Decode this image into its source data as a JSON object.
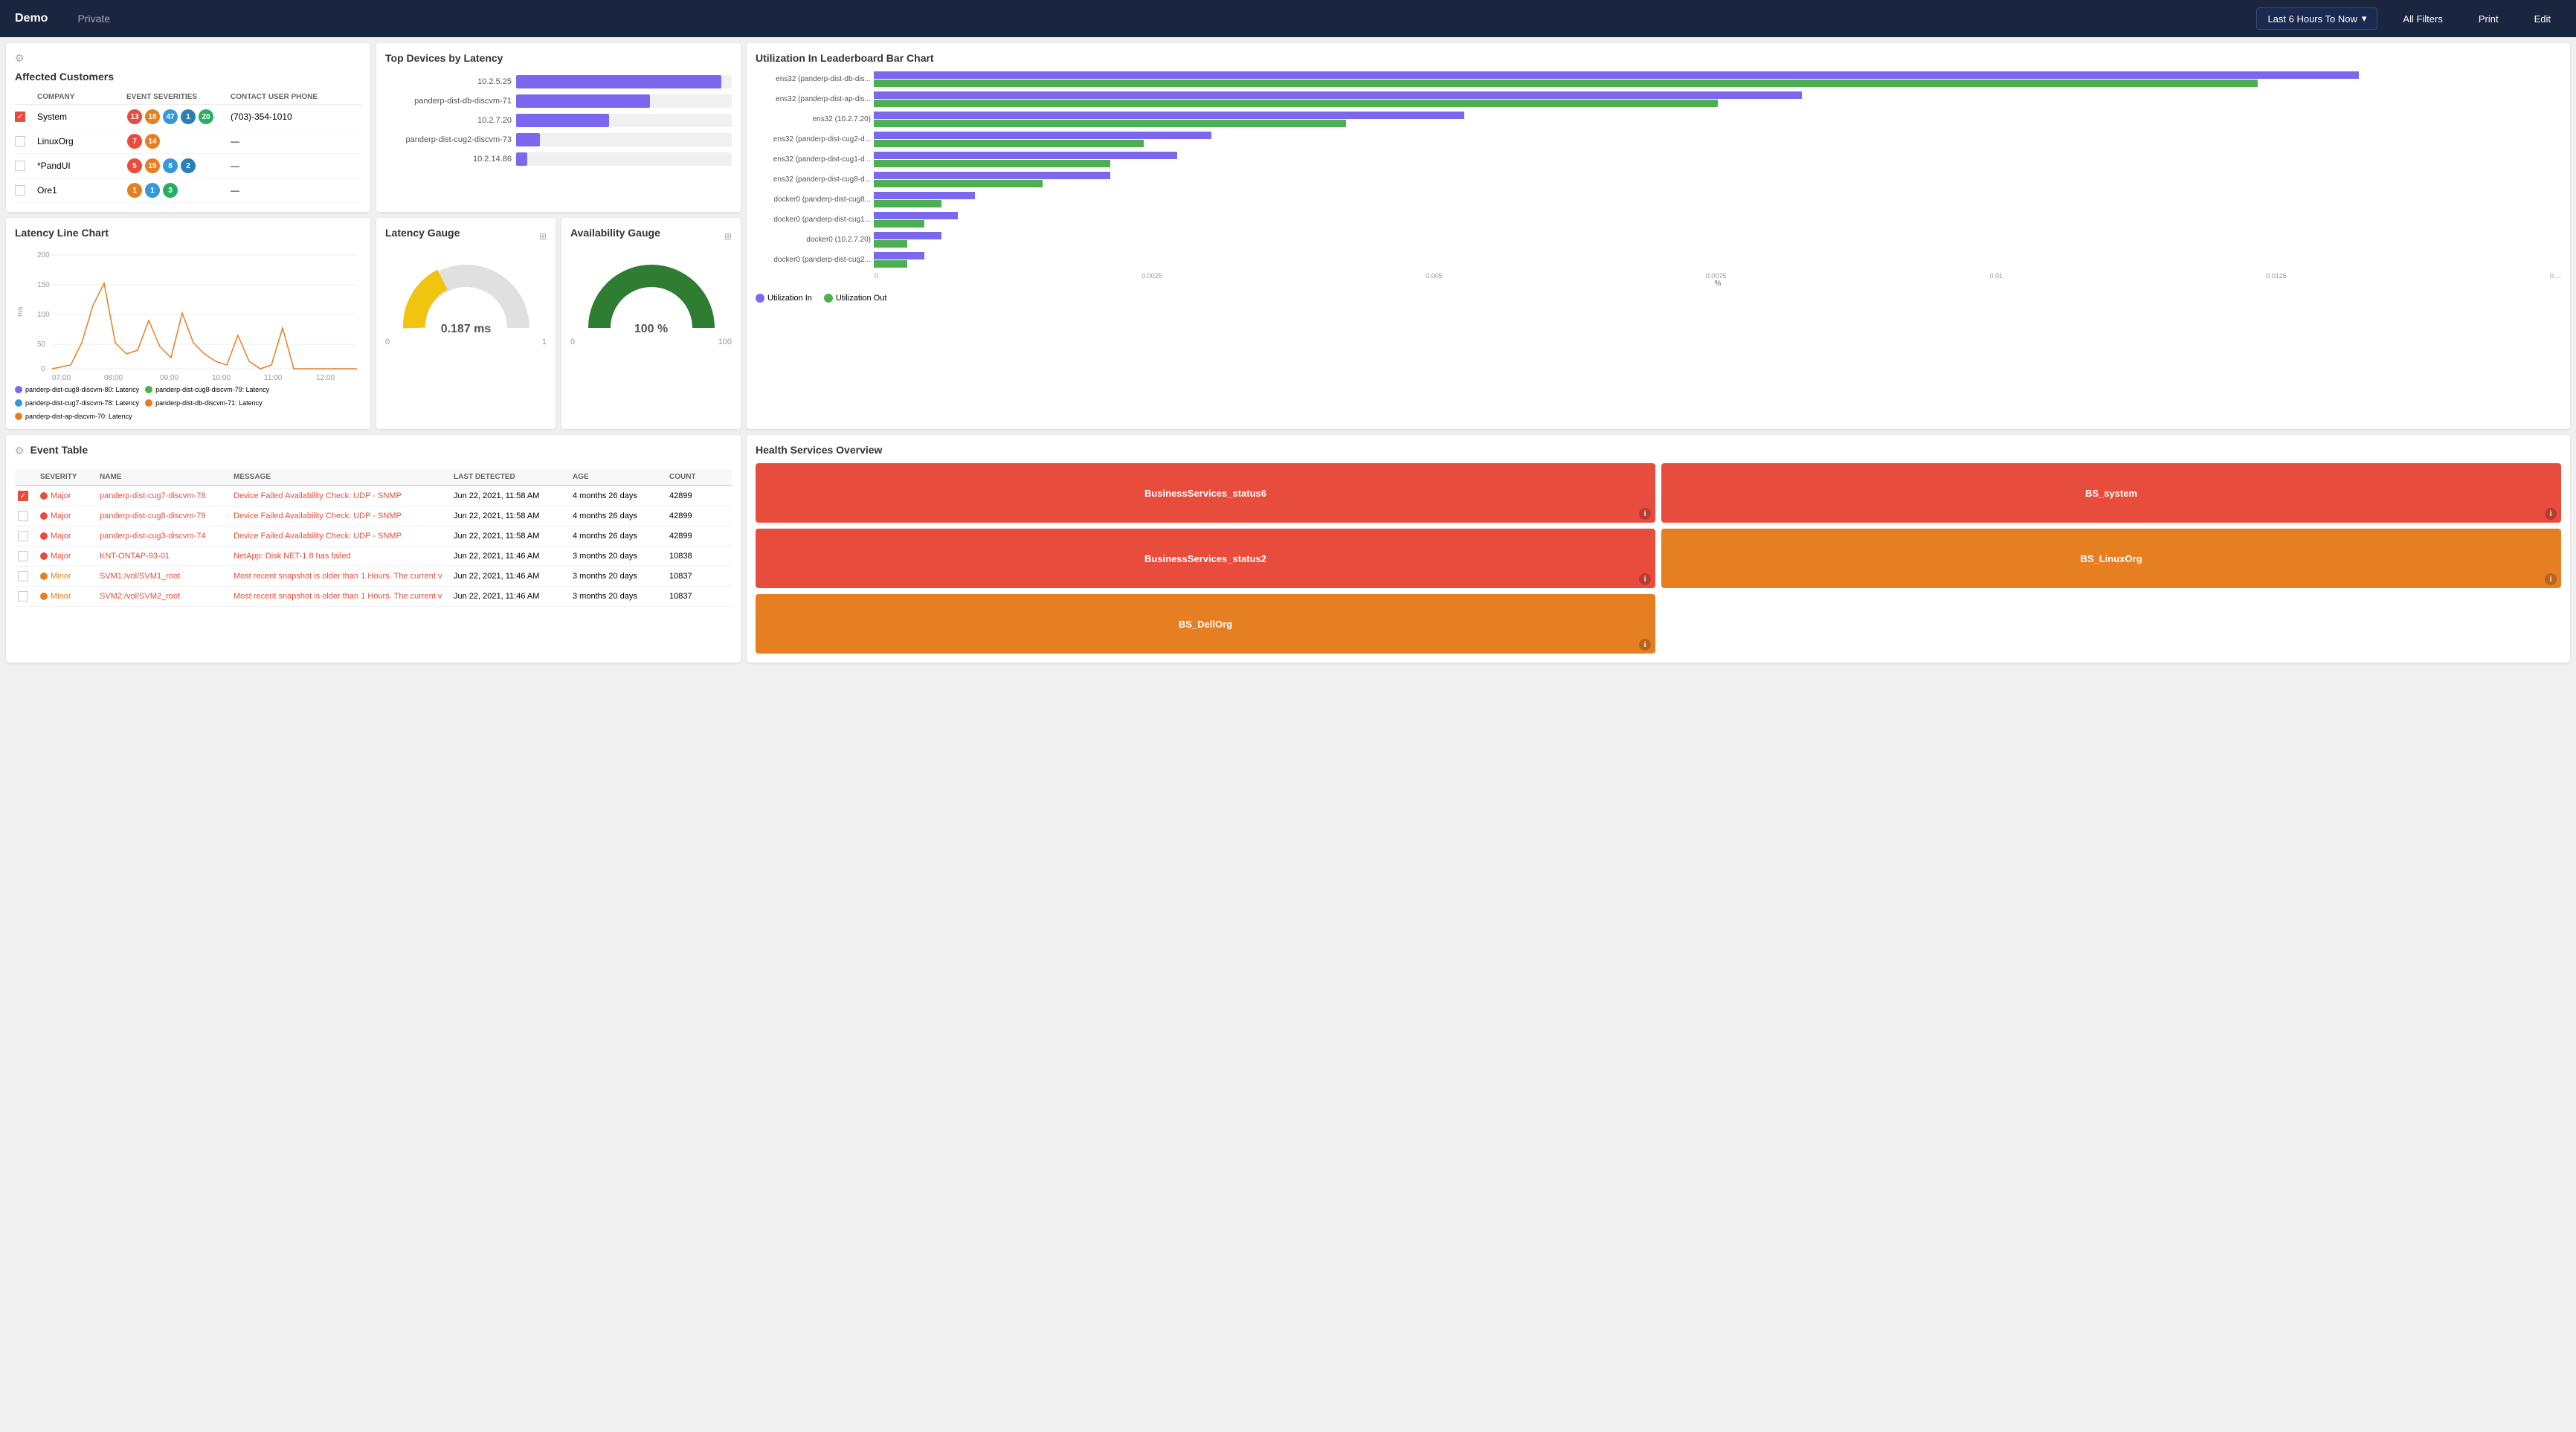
{
  "nav": {
    "title": "Demo",
    "private": "Private",
    "time_filter": "Last 6 Hours To Now",
    "all_filters": "All Filters",
    "print": "Print",
    "edit": "Edit"
  },
  "affected_customers": {
    "title": "Affected Customers",
    "columns": [
      "COMPANY",
      "EVENT SEVERITIES",
      "CONTACT USER PHONE"
    ],
    "rows": [
      {
        "company": "System",
        "severities": [
          {
            "val": "13",
            "cls": "badge-red"
          },
          {
            "val": "18",
            "cls": "badge-orange"
          },
          {
            "val": "47",
            "cls": "badge-blue-light"
          },
          {
            "val": "1",
            "cls": "badge-blue"
          },
          {
            "val": "20",
            "cls": "badge-green"
          }
        ],
        "phone": "(703)-354-1010",
        "checked": true
      },
      {
        "company": "LinuxOrg",
        "severities": [
          {
            "val": "7",
            "cls": "badge-red"
          },
          {
            "val": "14",
            "cls": "badge-orange"
          }
        ],
        "phone": "—",
        "checked": false
      },
      {
        "company": "*PandUI",
        "severities": [
          {
            "val": "5",
            "cls": "badge-red"
          },
          {
            "val": "15",
            "cls": "badge-orange"
          },
          {
            "val": "8",
            "cls": "badge-blue-light"
          },
          {
            "val": "2",
            "cls": "badge-blue"
          }
        ],
        "phone": "—",
        "checked": false
      },
      {
        "company": "Ore1",
        "severities": [
          {
            "val": "1",
            "cls": "badge-orange"
          },
          {
            "val": "1",
            "cls": "badge-blue-light"
          },
          {
            "val": "3",
            "cls": "badge-green"
          }
        ],
        "phone": "—",
        "checked": false
      }
    ]
  },
  "top_devices": {
    "title": "Top Devices by Latency",
    "bars": [
      {
        "label": "10.2.5.25",
        "value": 100,
        "pct": 95
      },
      {
        "label": "panderp-dist-db-discvm-71",
        "value": 65,
        "pct": 62
      },
      {
        "label": "10.2.7.20",
        "value": 45,
        "pct": 43
      },
      {
        "label": "panderp-dist-cug2-discvm-73",
        "value": 12,
        "pct": 11
      },
      {
        "label": "10.2.14.86",
        "value": 5,
        "pct": 5
      }
    ]
  },
  "utilization": {
    "title": "Utilization In Leaderboard Bar Chart",
    "x_labels": [
      "0",
      "0.0025",
      "0.005",
      "0.0075",
      "0.01",
      "0.0125",
      "0...."
    ],
    "x_axis_label": "%",
    "legend_in": "Utilization In",
    "legend_out": "Utilization Out",
    "bars": [
      {
        "label": "ens32 (panderp-dist-db-dis...",
        "in_pct": 88,
        "out_pct": 82
      },
      {
        "label": "ens32 (panderp-dist-ap-dis...",
        "in_pct": 55,
        "out_pct": 50
      },
      {
        "label": "ens32 (10.2.7.20)",
        "in_pct": 35,
        "out_pct": 28
      },
      {
        "label": "ens32 (panderp-dist-cug2-d...",
        "in_pct": 20,
        "out_pct": 16
      },
      {
        "label": "ens32 (panderp-dist-cug1-d...",
        "in_pct": 18,
        "out_pct": 14
      },
      {
        "label": "ens32 (panderp-dist-cug8-d...",
        "in_pct": 14,
        "out_pct": 10
      },
      {
        "label": "docker0 (panderp-dist-cug8...",
        "in_pct": 6,
        "out_pct": 4
      },
      {
        "label": "docker0 (panderp-dist-cug1...",
        "in_pct": 5,
        "out_pct": 3
      },
      {
        "label": "docker0 (10.2.7.20)",
        "in_pct": 4,
        "out_pct": 2
      },
      {
        "label": "docker0 (panderp-dist-cug2...",
        "in_pct": 3,
        "out_pct": 2
      }
    ]
  },
  "latency_line": {
    "title": "Latency Line Chart",
    "y_label": "ms",
    "y_ticks": [
      "200",
      "150",
      "100",
      "50",
      "0"
    ],
    "x_ticks": [
      "07:00",
      "08:00",
      "09:00",
      "10:00",
      "11:00",
      "12:00"
    ],
    "legend": [
      {
        "label": "panderp-dist-cug8-discvm-80: Latency",
        "color": "#7b68ee"
      },
      {
        "label": "panderp-dist-cug8-discvm-79: Latency",
        "color": "#4caf50"
      },
      {
        "label": "panderp-dist-cug7-discvm-78: Latency",
        "color": "#3498db"
      },
      {
        "label": "panderp-dist-db-discvm-71: Latency",
        "color": "#e67e22"
      },
      {
        "label": "panderp-dist-ap-discvm-70: Latency",
        "color": "#e67e22"
      }
    ]
  },
  "latency_gauge": {
    "title": "Latency Gauge",
    "value": "0.187 ms",
    "min": "0",
    "max": "1"
  },
  "availability_gauge": {
    "title": "Availability Gauge",
    "value": "100 %",
    "min": "0",
    "max": "100"
  },
  "event_table": {
    "title": "Event Table",
    "columns": [
      "SEVERITY",
      "NAME",
      "MESSAGE",
      "LAST DETECTED",
      "AGE",
      "COUNT"
    ],
    "rows": [
      {
        "severity": "Major",
        "severity_type": "major",
        "name": "panderp-dist-cug7-discvm-78",
        "message": "Device Failed Availability Check: UDP - SNMP",
        "last_detected": "Jun 22, 2021, 11:58 AM",
        "age": "4 months 26 days",
        "count": "42899",
        "checked": true
      },
      {
        "severity": "Major",
        "severity_type": "major",
        "name": "panderp-dist-cug8-discvm-79",
        "message": "Device Failed Availability Check: UDP - SNMP",
        "last_detected": "Jun 22, 2021, 11:58 AM",
        "age": "4 months 26 days",
        "count": "42899",
        "checked": false
      },
      {
        "severity": "Major",
        "severity_type": "major",
        "name": "panderp-dist-cug3-discvm-74",
        "message": "Device Failed Availability Check: UDP - SNMP",
        "last_detected": "Jun 22, 2021, 11:58 AM",
        "age": "4 months 26 days",
        "count": "42899",
        "checked": false
      },
      {
        "severity": "Major",
        "severity_type": "major",
        "name": "KNT-ONTAP-93-01",
        "message": "NetApp: Disk NET-1.8 has failed",
        "last_detected": "Jun 22, 2021, 11:46 AM",
        "age": "3 months 20 days",
        "count": "10838",
        "checked": false
      },
      {
        "severity": "Minor",
        "severity_type": "minor",
        "name": "SVM1:/vol/SVM1_root",
        "message": "Most recent snapshot is older than 1 Hours. The current v",
        "last_detected": "Jun 22, 2021, 11:46 AM",
        "age": "3 months 20 days",
        "count": "10837",
        "checked": false
      },
      {
        "severity": "Minor",
        "severity_type": "minor",
        "name": "SVM2:/vol/SVM2_root",
        "message": "Most recent snapshot is older than 1 Hours. The current v",
        "last_detected": "Jun 22, 2021, 11:46 AM",
        "age": "3 months 20 days",
        "count": "10837",
        "checked": false
      }
    ]
  },
  "health_services": {
    "title": "Health Services Overview",
    "tiles": [
      {
        "label": "BusinessServices_status6",
        "color": "hs-red"
      },
      {
        "label": "BS_system",
        "color": "hs-red"
      },
      {
        "label": "BusinessServices_status2",
        "color": "hs-red"
      },
      {
        "label": "BS_LinuxOrg",
        "color": "hs-orange"
      },
      {
        "label": "BS_DellOrg",
        "color": "hs-orange"
      }
    ]
  }
}
